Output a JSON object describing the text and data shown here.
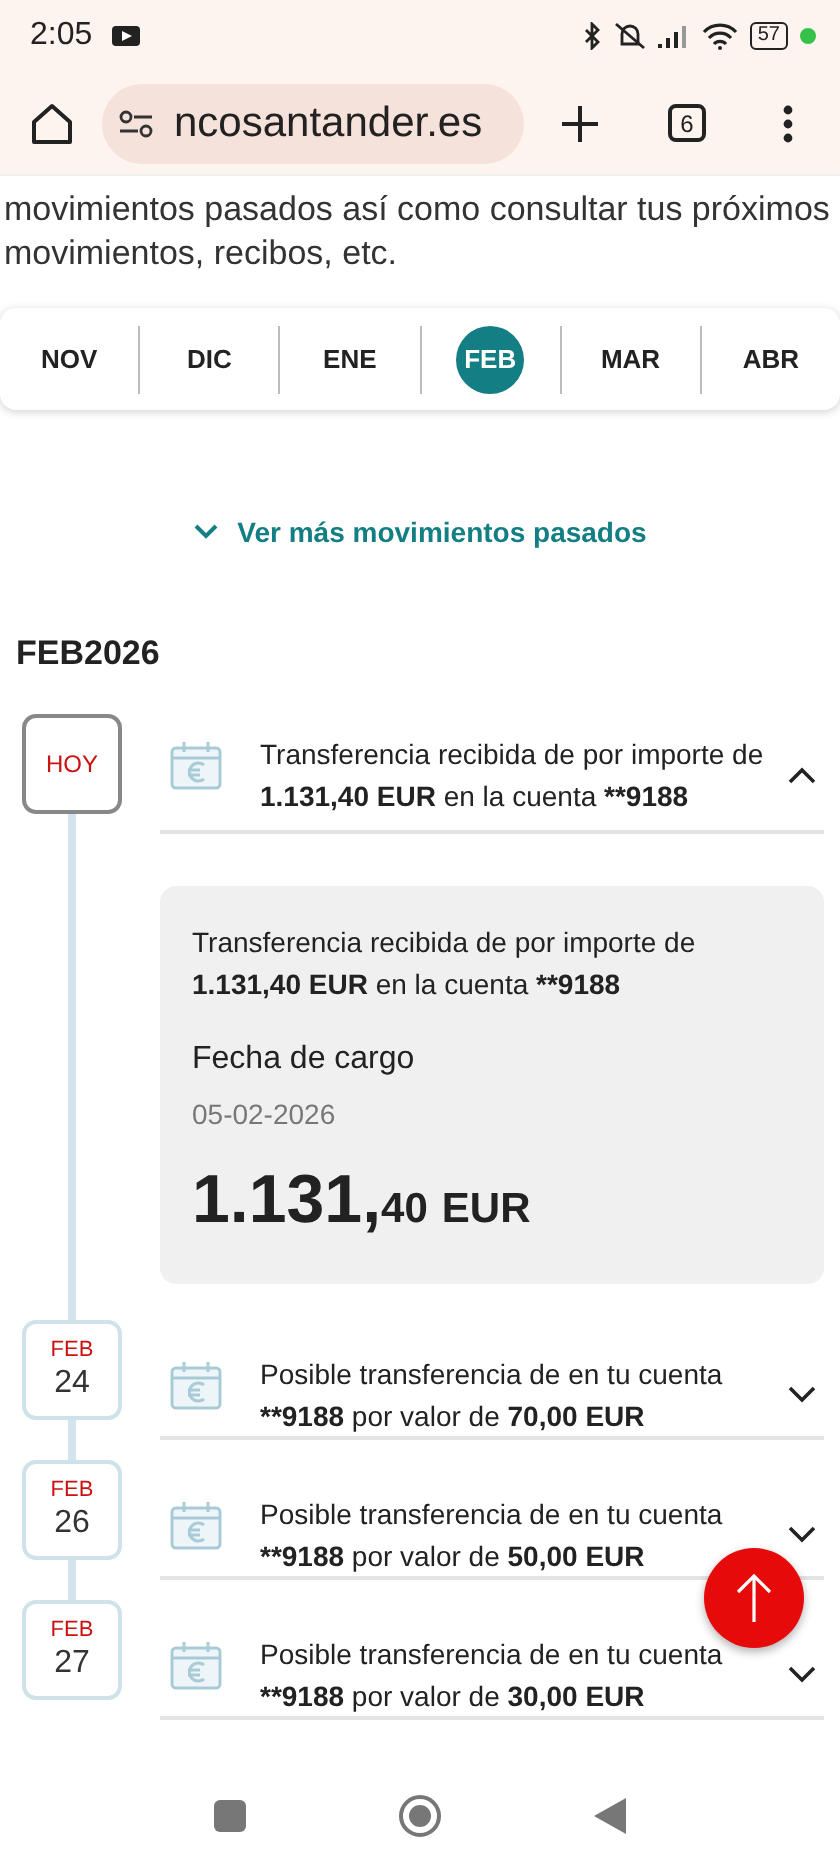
{
  "status_bar": {
    "time": "2:05",
    "battery": "57"
  },
  "browser": {
    "url": "ncosantander.es",
    "tab_count": "6"
  },
  "intro": [
    "movimientos pasados así como consultar tus próximos",
    "movimientos, recibos, etc."
  ],
  "months": [
    {
      "label": "NOV",
      "selected": false
    },
    {
      "label": "DIC",
      "selected": false
    },
    {
      "label": "ENE",
      "selected": false
    },
    {
      "label": "FEB",
      "selected": true
    },
    {
      "label": "MAR",
      "selected": false
    },
    {
      "label": "ABR",
      "selected": false
    }
  ],
  "more_link": "Ver más movimientos pasados",
  "period": "FEB2026",
  "movements": [
    {
      "kind": "today",
      "date_label": "HOY",
      "text": "Transferencia recibida de por importe de **1.131,40 EUR** en la cuenta ****9188**",
      "expanded": true,
      "detail": {
        "text": "Transferencia recibida de por importe de **1.131,40 EUR** en la cuenta ****9188**",
        "label": "Fecha de cargo",
        "date": "05-02-2026",
        "amount_whole": "1.131,",
        "amount_cents": "40",
        "currency": "EUR"
      }
    },
    {
      "kind": "date",
      "month": "FEB",
      "day": "24",
      "text": "Posible transferencia de en tu cuenta ****9188** por valor de **70,00 EUR**",
      "expanded": false
    },
    {
      "kind": "date",
      "month": "FEB",
      "day": "26",
      "text": "Posible transferencia de en tu cuenta ****9188** por valor de **50,00 EUR**",
      "expanded": false
    },
    {
      "kind": "date",
      "month": "FEB",
      "day": "27",
      "text": "Posible transferencia de en tu cuenta ****9188** por valor de **30,00 EUR**",
      "expanded": false
    }
  ]
}
